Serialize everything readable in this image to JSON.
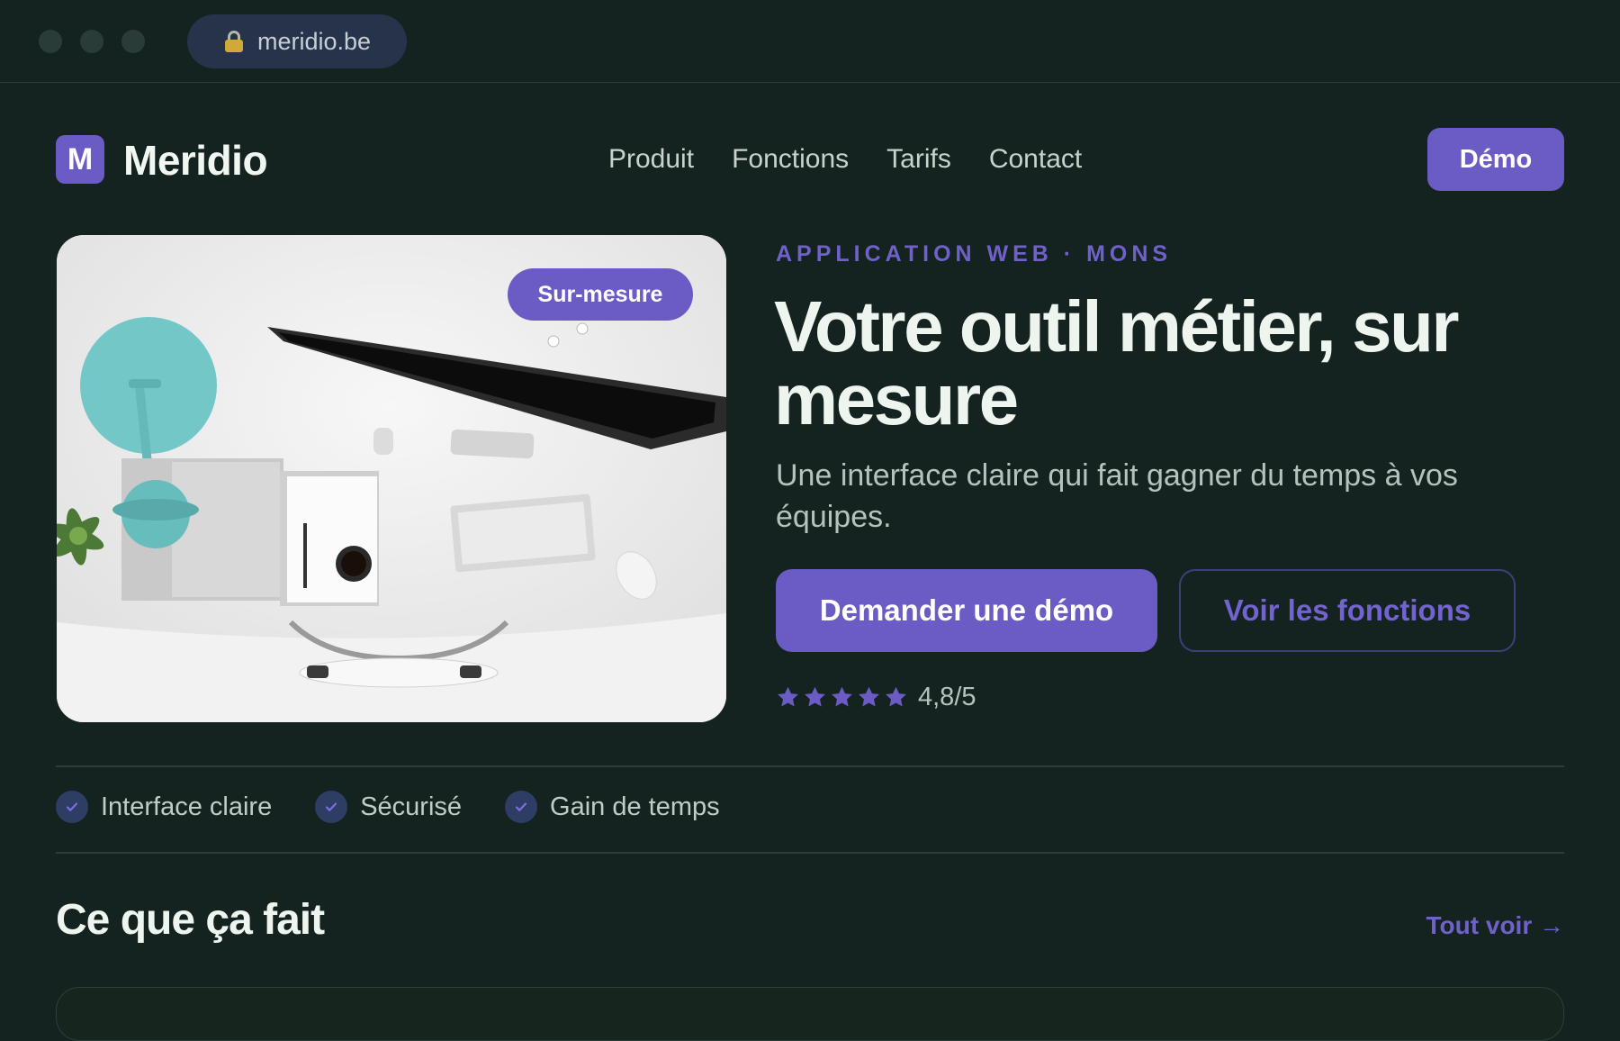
{
  "browser": {
    "url": "meridio.be",
    "icons": [
      "window-dot",
      "lock-icon"
    ]
  },
  "nav": {
    "logo_letter": "M",
    "brand": "Meridio",
    "links": [
      "Produit",
      "Fonctions",
      "Tarifs",
      "Contact"
    ],
    "demo_label": "Démo"
  },
  "hero": {
    "image_badge": "Sur-mesure",
    "eyebrow": "APPLICATION WEB · MONS",
    "headline": "Votre outil métier, sur mesure",
    "subline": "Une interface claire qui fait gagner du temps à vos équipes.",
    "primary_cta": "Demander une démo",
    "secondary_cta": "Voir les fonctions",
    "rating_stars": 5,
    "rating_text": "4,8/5"
  },
  "features": [
    "Interface claire",
    "Sécurisé",
    "Gain de temps"
  ],
  "section": {
    "title": "Ce que ça fait",
    "see_all": "Tout voir →"
  },
  "colors": {
    "background": "#142320",
    "accent": "#6b5bc4",
    "text": "#eef5ef",
    "muted": "#b6c3bd"
  }
}
